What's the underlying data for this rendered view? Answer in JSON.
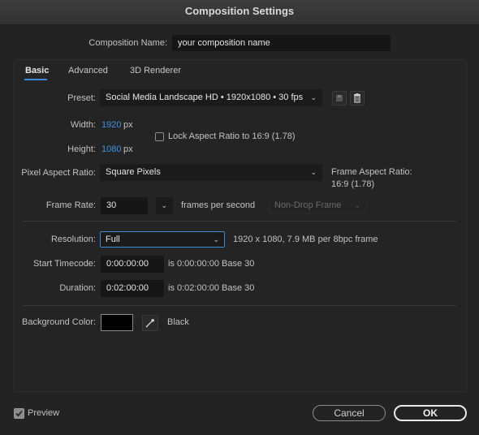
{
  "window": {
    "title": "Composition Settings"
  },
  "composition_name": {
    "label": "Composition Name:",
    "value": "your composition name"
  },
  "tabs": [
    {
      "label": "Basic",
      "active": true
    },
    {
      "label": "Advanced",
      "active": false
    },
    {
      "label": "3D Renderer",
      "active": false
    }
  ],
  "preset": {
    "label": "Preset:",
    "value": "Social Media Landscape HD  •  1920x1080 • 30 fps"
  },
  "width": {
    "label": "Width:",
    "value": "1920",
    "unit": "px"
  },
  "height": {
    "label": "Height:",
    "value": "1080",
    "unit": "px"
  },
  "lock_aspect": {
    "label": "Lock Aspect Ratio to 16:9 (1.78)",
    "checked": false
  },
  "pixel_aspect": {
    "label": "Pixel Aspect Ratio:",
    "value": "Square Pixels"
  },
  "frame_aspect": {
    "label": "Frame Aspect Ratio:",
    "value": "16:9 (1.78)"
  },
  "frame_rate": {
    "label": "Frame Rate:",
    "value": "30",
    "unit_label": "frames per second",
    "drop_frame": "Non-Drop Frame"
  },
  "resolution": {
    "label": "Resolution:",
    "value": "Full",
    "info": "1920 x 1080, 7.9 MB per 8bpc frame"
  },
  "start_timecode": {
    "label": "Start Timecode:",
    "value": "0:00:00:00",
    "info": "is 0:00:00:00  Base 30"
  },
  "duration": {
    "label": "Duration:",
    "value": "0:02:00:00",
    "info": "is 0:02:00:00  Base 30"
  },
  "background": {
    "label": "Background Color:",
    "color_hex": "#000000",
    "color_name": "Black"
  },
  "preview": {
    "label": "Preview",
    "checked": true
  },
  "buttons": {
    "cancel": "Cancel",
    "ok": "OK"
  },
  "colors": {
    "accent": "#3d94e6",
    "focus_border": "#3f8ad8"
  },
  "icons": [
    "save-preset-icon",
    "trash-icon",
    "eyedropper-icon",
    "chevron-down-icon",
    "checkmark-icon"
  ]
}
